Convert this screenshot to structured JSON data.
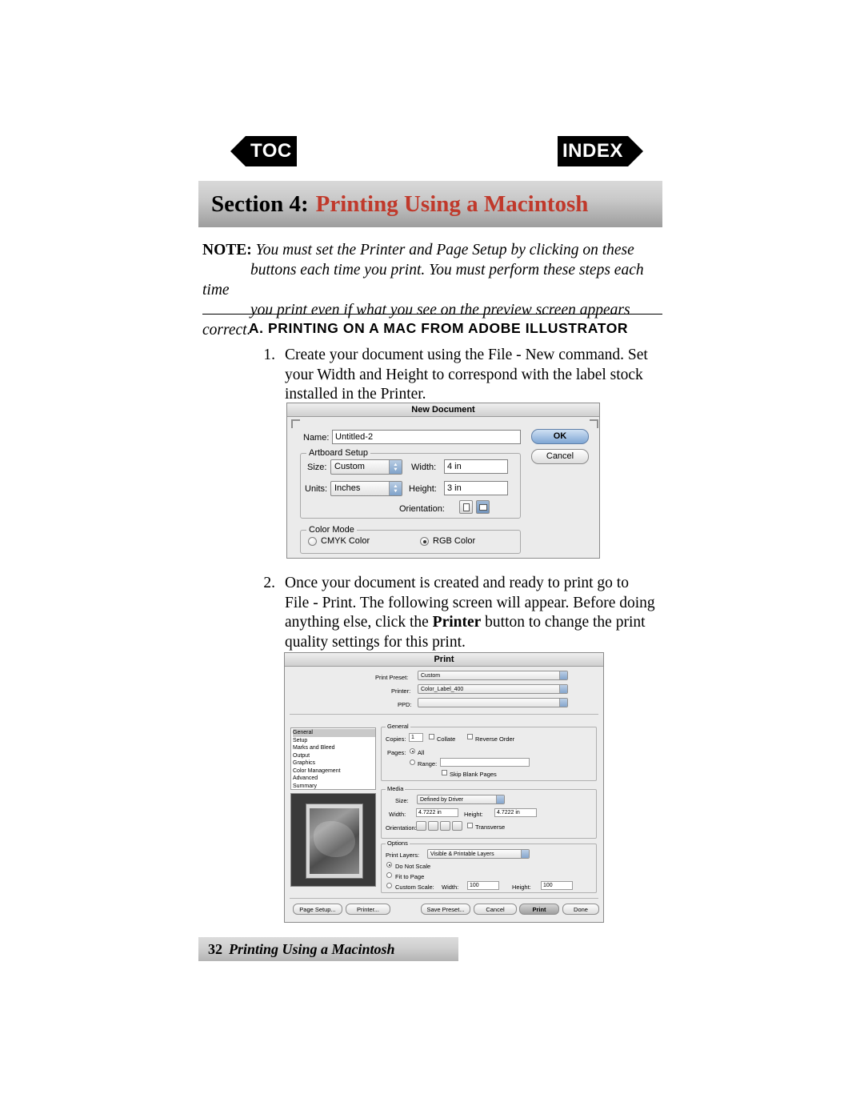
{
  "nav": {
    "toc_label": "TOC",
    "index_label": "INDEX"
  },
  "section": {
    "label": "Section 4:",
    "title": "Printing Using a Macintosh",
    "accent_color": "#c0392b"
  },
  "note": {
    "label": "NOTE:",
    "line1": "You must set the Printer and Page Setup by clicking on these",
    "line2": "buttons each time you print. You must perform these steps each time",
    "line3": "you print even if what you see on the preview screen appears correct."
  },
  "heading": {
    "a": "A. PRINTING ON A MAC FROM ADOBE ILLUSTRATOR"
  },
  "steps": [
    {
      "number": "1.",
      "line1": "Create your document using the File - New command. Set",
      "line2": "your Width and Height to correspond with the label stock",
      "line3": "installed in the Printer."
    },
    {
      "number": "2.",
      "line1": "Once your document is created and ready to print go to",
      "line2": "File - Print. The following screen will appear. Before doing",
      "line3_a": "anything else, click the ",
      "line3_b": "Printer",
      "line3_c": " button to change the print",
      "line4": "quality settings for this print."
    }
  ],
  "new_document_dialog": {
    "title": "New Document",
    "name_label": "Name:",
    "name_value": "Untitled-2",
    "ok_label": "OK",
    "cancel_label": "Cancel",
    "artboard_group": "Artboard Setup",
    "size_label": "Size:",
    "size_value": "Custom",
    "width_label": "Width:",
    "width_value": "4 in",
    "units_label": "Units:",
    "units_value": "Inches",
    "height_label": "Height:",
    "height_value": "3 in",
    "orientation_label": "Orientation:",
    "color_group": "Color Mode",
    "cmyk_label": "CMYK Color",
    "rgb_label": "RGB Color",
    "color_selected": "RGB Color"
  },
  "print_dialog": {
    "title": "Print",
    "print_preset_label": "Print Preset:",
    "print_preset_value": "Custom",
    "printer_label": "Printer:",
    "printer_value": "Color_Label_400",
    "ppd_label": "PPD:",
    "ppd_value": "",
    "side_items": [
      "General",
      "Setup",
      "Marks and Bleed",
      "Output",
      "Graphics",
      "Color Management",
      "Advanced",
      "Summary"
    ],
    "side_selected": "General",
    "general_group": "General",
    "copies_label": "Copies:",
    "copies_value": "1",
    "collate_label": "Collate",
    "reverse_order_label": "Reverse Order",
    "pages_label": "Pages:",
    "all_label": "All",
    "range_label": "Range:",
    "range_value": "",
    "skip_blank_label": "Skip Blank Pages",
    "media_group": "Media",
    "media_size_label": "Size:",
    "media_size_value": "Defined by Driver",
    "media_width_label": "Width:",
    "media_width_value": "4.7222 in",
    "media_height_label": "Height:",
    "media_height_value": "4.7222 in",
    "media_orientation_label": "Orientation:",
    "transverse_label": "Transverse",
    "options_group": "Options",
    "print_layers_label": "Print Layers:",
    "print_layers_value": "Visible & Printable Layers",
    "do_not_scale_label": "Do Not Scale",
    "fit_to_page_label": "Fit to Page",
    "custom_scale_label": "Custom Scale:",
    "custom_width_label": "Width:",
    "custom_width_value": "100",
    "custom_height_label": "Height:",
    "custom_height_value": "100",
    "page_setup_btn": "Page Setup...",
    "printer_btn": "Printer...",
    "save_preset_btn": "Save Preset...",
    "cancel_btn": "Cancel",
    "print_btn": "Print",
    "done_btn": "Done"
  },
  "footer": {
    "page": "32",
    "text": "Printing Using a Macintosh"
  }
}
